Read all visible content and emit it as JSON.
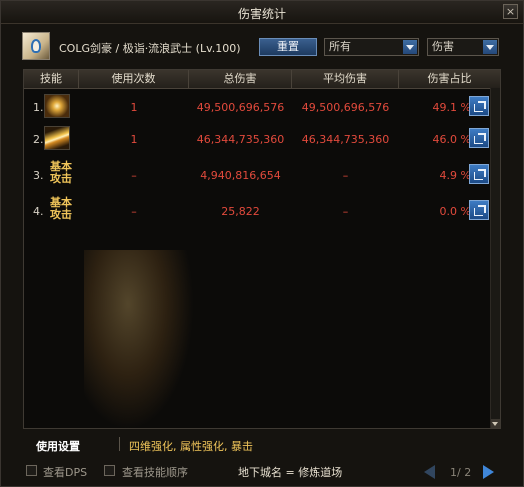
{
  "window": {
    "title": "伤害统计",
    "close_label": "×"
  },
  "header": {
    "character": "COLG剑豪 / 极诣·流浪武士 (Lv.100)",
    "reset_label": "重置",
    "filter_value": "所有",
    "metric_value": "伤害"
  },
  "table": {
    "columns": [
      "技能",
      "使用次数",
      "总伤害",
      "平均伤害",
      "伤害占比"
    ],
    "rows": [
      {
        "index": "1.",
        "icon": "skill-slash-icon",
        "skill_text": "",
        "uses": "1",
        "total": "49,500,696,576",
        "avg": "49,500,696,576",
        "ratio": "49.1 %"
      },
      {
        "index": "2.",
        "icon": "skill-gold-wave-icon",
        "skill_text": "",
        "uses": "1",
        "total": "46,344,735,360",
        "avg": "46,344,735,360",
        "ratio": "46.0 %"
      },
      {
        "index": "3.",
        "icon": "",
        "skill_text": "基本攻击",
        "uses": "–",
        "total": "4,940,816,654",
        "avg": "–",
        "ratio": "4.9 %"
      },
      {
        "index": "4.",
        "icon": "",
        "skill_text": "基本攻击",
        "uses": "–",
        "total": "25,822",
        "avg": "–",
        "ratio": "0.0 %"
      }
    ]
  },
  "settings": {
    "label": "使用设置",
    "value": "四维强化, 属性强化, 暴击"
  },
  "footer": {
    "show_dps": "查看DPS",
    "show_order": "查看技能顺序",
    "dungeon": "地下城名 = 修炼道场",
    "page": "1/ 2"
  },
  "colors": {
    "accent": "#3e7cc4",
    "damage": "#e24a3c",
    "gold": "#f0c55a"
  }
}
